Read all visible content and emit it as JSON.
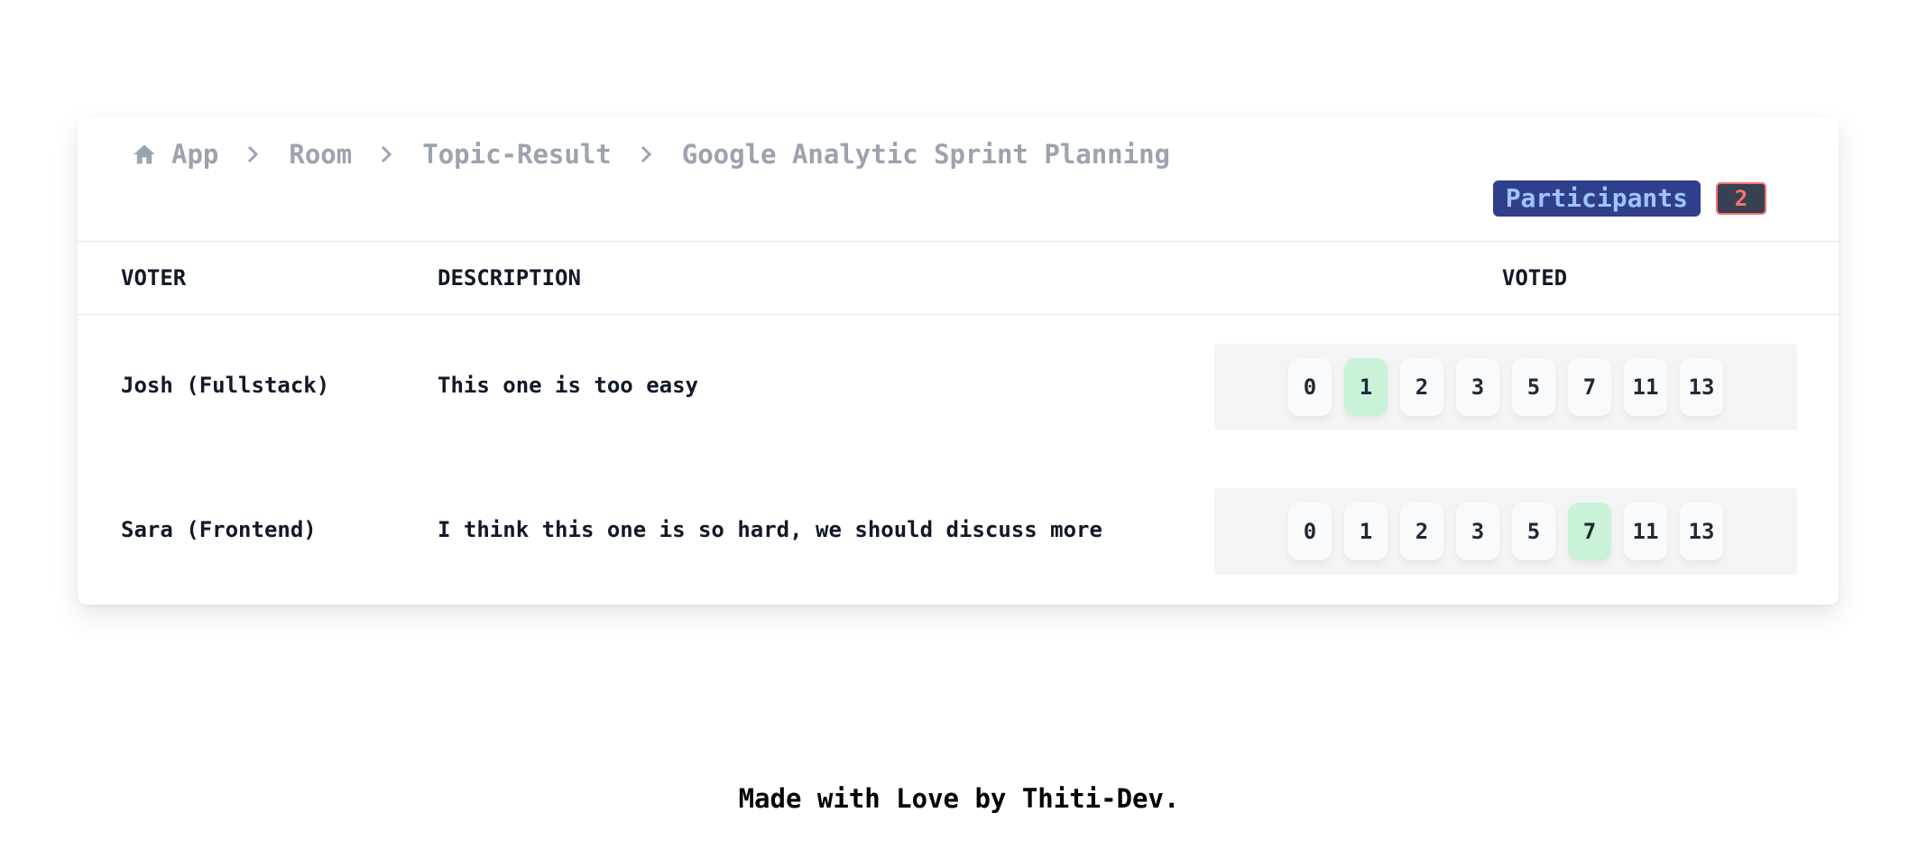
{
  "breadcrumb": {
    "home_icon": "home-icon",
    "items": [
      "App",
      "Room",
      "Topic-Result",
      "Google Analytic Sprint Planning"
    ]
  },
  "participants": {
    "label": "Participants",
    "count": "2"
  },
  "table": {
    "headers": {
      "voter": "VOTER",
      "description": "DESCRIPTION",
      "voted": "VOTED"
    },
    "vote_options": [
      "0",
      "1",
      "2",
      "3",
      "5",
      "7",
      "11",
      "13"
    ],
    "rows": [
      {
        "voter": "Josh (Fullstack)",
        "description": "This one is too easy",
        "selected": "1"
      },
      {
        "voter": "Sara (Frontend)",
        "description": "I think this one is so hard, we should discuss more",
        "selected": "7"
      }
    ]
  },
  "footer": {
    "text": "Made with Love by Thiti-Dev."
  },
  "colors": {
    "selected_chip": "#c9f2d8",
    "participants_bg": "#2f3f8c",
    "participants_text": "#9fc4ff",
    "count_text": "#f87171",
    "breadcrumb_text": "#9ca3af"
  }
}
